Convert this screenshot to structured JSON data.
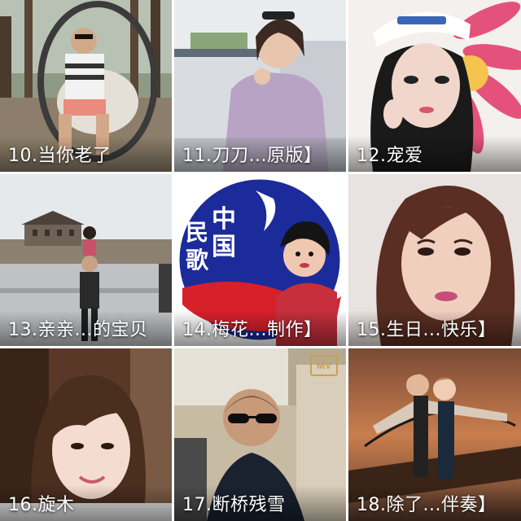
{
  "tiles": [
    {
      "label": "10.当你老了",
      "icon": "photo-man-hanging-chair"
    },
    {
      "label": "11.刀刀...原版】",
      "icon": "photo-woman-sunglasses"
    },
    {
      "label": "12.宠爱",
      "icon": "photo-girl-cap"
    },
    {
      "label": "13.亲亲...的宝贝",
      "icon": "photo-city-wall"
    },
    {
      "label": "14.梅花...制作】",
      "icon": "logo-folk-songs"
    },
    {
      "label": "15.生日...快乐】",
      "icon": "photo-woman-closeup"
    },
    {
      "label": "16.旋木",
      "icon": "photo-girl-smiling"
    },
    {
      "label": "17.断桥残雪",
      "icon": "photo-man-car"
    },
    {
      "label": "18.除了...伴奏】",
      "icon": "photo-titanic"
    }
  ],
  "logo": {
    "line1": "中",
    "line2": "民",
    "line3": "国",
    "line4": "歌"
  },
  "badge": "MV"
}
